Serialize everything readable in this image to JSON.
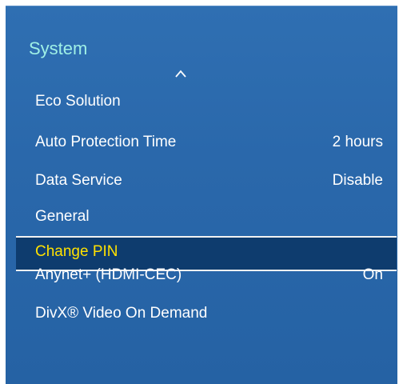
{
  "menu": {
    "title": "System",
    "items": [
      {
        "label": "Eco Solution",
        "value": ""
      },
      {
        "label": "Auto Protection Time",
        "value": "2 hours"
      },
      {
        "label": "Data Service",
        "value": "Disable"
      },
      {
        "label": "General",
        "value": ""
      },
      {
        "label": "Change PIN",
        "value": ""
      },
      {
        "label": "Anynet+ (HDMI-CEC)",
        "value": "On"
      },
      {
        "label": "DivX® Video On Demand",
        "value": ""
      }
    ],
    "selected_index": 4,
    "scroll_indicator_icon": "chevron-up-icon"
  },
  "colors": {
    "panel_background": "#2a68ab",
    "title": "#9ff0e6",
    "highlight_background": "#0e3c6e",
    "highlight_text": "#ffe100",
    "text": "#ffffff"
  }
}
